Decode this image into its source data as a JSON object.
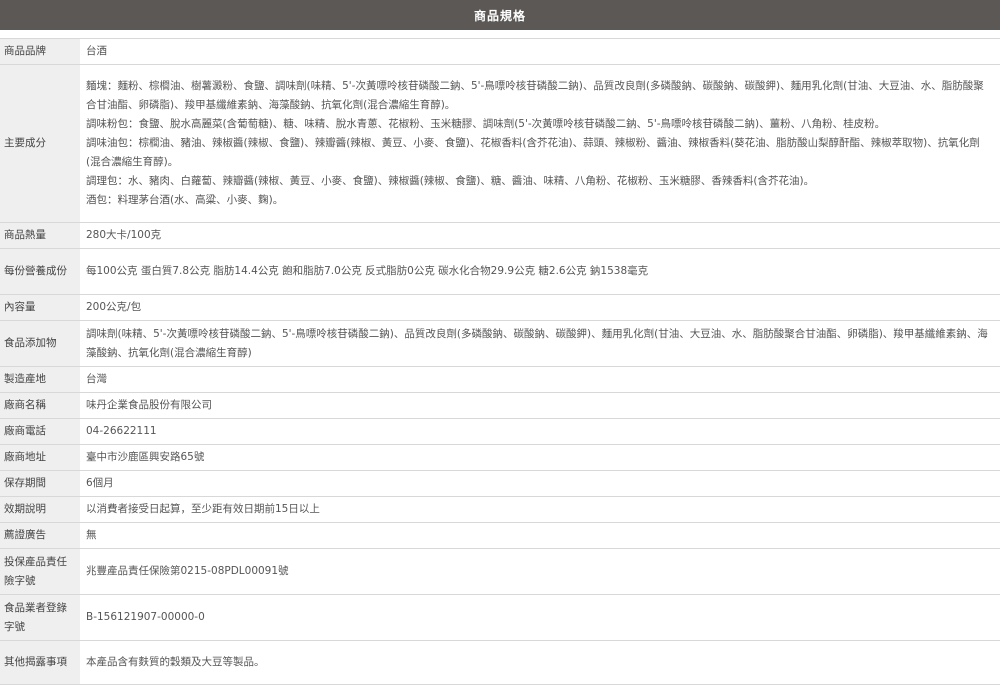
{
  "header": {
    "title": "商品規格"
  },
  "rows": {
    "brand": {
      "label": "商品品牌",
      "value": "台酒"
    },
    "ingredients": {
      "label": "主要成分",
      "lines": [
        "麵塊：麵粉、棕櫚油、樹薯澱粉、食鹽、調味劑(味精、5'-次黃嘌呤核苷磷酸二鈉、5'-鳥嘌呤核苷磷酸二鈉)、品質改良劑(多磷酸鈉、碳酸鈉、碳酸鉀)、麵用乳化劑(甘油、大豆油、水、脂肪酸聚合甘油酯、卵磷脂)、羧甲基纖維素鈉、海藻酸鈉、抗氧化劑(混合濃縮生育醇)。",
        "調味粉包：食鹽、脫水高麗菜(含葡萄糖)、糖、味精、脫水青蔥、花椒粉、玉米糖膠、調味劑(5'-次黃嘌呤核苷磷酸二鈉、5'-鳥嘌呤核苷磷酸二鈉)、薑粉、八角粉、桂皮粉。",
        "調味油包：棕櫚油、豬油、辣椒醬(辣椒、食鹽)、辣瓣醬(辣椒、黃豆、小麥、食鹽)、花椒香料(含芥花油)、蒜頭、辣椒粉、醬油、辣椒香料(葵花油、脂肪酸山梨醇酐酯、辣椒萃取物)、抗氧化劑(混合濃縮生育醇)。",
        "調理包：水、豬肉、白蘿蔔、辣瓣醬(辣椒、黃豆、小麥、食鹽)、辣椒醬(辣椒、食鹽)、糖、醬油、味精、八角粉、花椒粉、玉米糖膠、香辣香料(含芥花油)。",
        "酒包：料理茅台酒(水、高粱、小麥、麴)。"
      ]
    },
    "calories": {
      "label": "商品熱量",
      "value": "280大卡/100克"
    },
    "nutrition": {
      "label": "每份營養成份",
      "value": "每100公克 蛋白質7.8公克 脂肪14.4公克 飽和脂肪7.0公克 反式脂肪0公克 碳水化合物29.9公克 糖2.6公克 鈉1538毫克"
    },
    "content": {
      "label": "內容量",
      "value": "200公克/包"
    },
    "additives": {
      "label": "食品添加物",
      "value": "調味劑(味精、5'-次黃嘌呤核苷磷酸二鈉、5'-鳥嘌呤核苷磷酸二鈉)、品質改良劑(多磷酸鈉、碳酸鈉、碳酸鉀)、麵用乳化劑(甘油、大豆油、水、脂肪酸聚合甘油酯、卵磷脂)、羧甲基纖維素鈉、海藻酸鈉、抗氧化劑(混合濃縮生育醇)"
    },
    "origin": {
      "label": "製造產地",
      "value": "台灣"
    },
    "manufacturer": {
      "label": "廠商名稱",
      "value": "味丹企業食品股份有限公司"
    },
    "phone": {
      "label": "廠商電話",
      "value": "04-26622111"
    },
    "address": {
      "label": "廠商地址",
      "value": "臺中市沙鹿區興安路65號"
    },
    "shelf_life": {
      "label": "保存期間",
      "value": "6個月"
    },
    "expiry_note": {
      "label": "效期說明",
      "value": "以消費者接受日起算，至少距有效日期前15日以上"
    },
    "endorsement": {
      "label": "薦證廣告",
      "value": "無"
    },
    "insurance": {
      "label": "投保產品責任險字號",
      "value": "兆豐產品責任保險第0215-08PDL00091號"
    },
    "registration": {
      "label": "食品業者登錄字號",
      "value": "B-156121907-00000-0"
    },
    "disclosure": {
      "label": "其他揭露事項",
      "value": "本產品含有麩質的穀類及大豆等製品。"
    }
  }
}
